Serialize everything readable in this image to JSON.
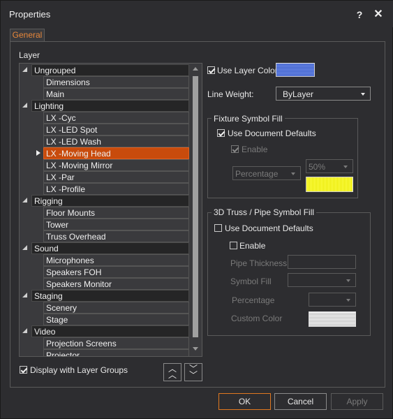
{
  "window": {
    "title": "Properties",
    "help_label": "?",
    "close_label": "✕"
  },
  "tabs": [
    {
      "label": "General",
      "active": true
    }
  ],
  "layer": {
    "section_label": "Layer",
    "tree": [
      {
        "type": "group",
        "label": "Ungrouped"
      },
      {
        "type": "item",
        "label": "Dimensions"
      },
      {
        "type": "item",
        "label": "Main"
      },
      {
        "type": "group",
        "label": "Lighting"
      },
      {
        "type": "item",
        "label": "LX -Cyc"
      },
      {
        "type": "item",
        "label": "LX -LED Spot"
      },
      {
        "type": "item",
        "label": "LX -LED Wash"
      },
      {
        "type": "item",
        "label": "LX -Moving Head",
        "selected": true
      },
      {
        "type": "item",
        "label": "LX -Moving Mirror"
      },
      {
        "type": "item",
        "label": "LX -Par"
      },
      {
        "type": "item",
        "label": "LX -Profile"
      },
      {
        "type": "group",
        "label": "Rigging"
      },
      {
        "type": "item",
        "label": "Floor Mounts"
      },
      {
        "type": "item",
        "label": "Tower"
      },
      {
        "type": "item",
        "label": "Truss Overhead"
      },
      {
        "type": "group",
        "label": "Sound"
      },
      {
        "type": "item",
        "label": "Microphones"
      },
      {
        "type": "item",
        "label": "Speakers FOH"
      },
      {
        "type": "item",
        "label": "Speakers Monitor"
      },
      {
        "type": "group",
        "label": "Staging"
      },
      {
        "type": "item",
        "label": "Scenery"
      },
      {
        "type": "item",
        "label": "Stage"
      },
      {
        "type": "group",
        "label": "Video"
      },
      {
        "type": "item",
        "label": "Projection Screens"
      },
      {
        "type": "item",
        "label": "Projector"
      }
    ],
    "display_with_groups_label": "Display with Layer Groups",
    "display_with_groups_checked": true,
    "move_up_icon": "double-chevron-up-icon",
    "move_down_icon": "double-chevron-down-icon"
  },
  "properties": {
    "use_layer_color_label": "Use Layer Color",
    "use_layer_color_checked": true,
    "layer_color": "#5a78d8",
    "line_weight_label": "Line Weight:",
    "line_weight_value": "ByLayer",
    "fixture_fill": {
      "title": "Fixture Symbol Fill",
      "use_defaults_label": "Use Document Defaults",
      "use_defaults_checked": true,
      "enable_label": "Enable",
      "enable_checked": true,
      "type_value": "Percentage",
      "percent_value": "50%",
      "fill_color": "#f0f000"
    },
    "truss_fill": {
      "title": "3D Truss / Pipe Symbol Fill",
      "use_defaults_label": "Use Document Defaults",
      "use_defaults_checked": false,
      "enable_label": "Enable",
      "enable_checked": false,
      "pipe_thickness_label": "Pipe Thickness",
      "symbol_fill_label": "Symbol Fill",
      "percentage_label": "Percentage",
      "custom_color_label": "Custom Color",
      "custom_color": "#d8d8d8"
    }
  },
  "footer": {
    "ok_label": "OK",
    "cancel_label": "Cancel",
    "apply_label": "Apply"
  },
  "colors": {
    "accent": "#e07820",
    "selection": "#c84b0c",
    "background": "#2d2d30"
  }
}
